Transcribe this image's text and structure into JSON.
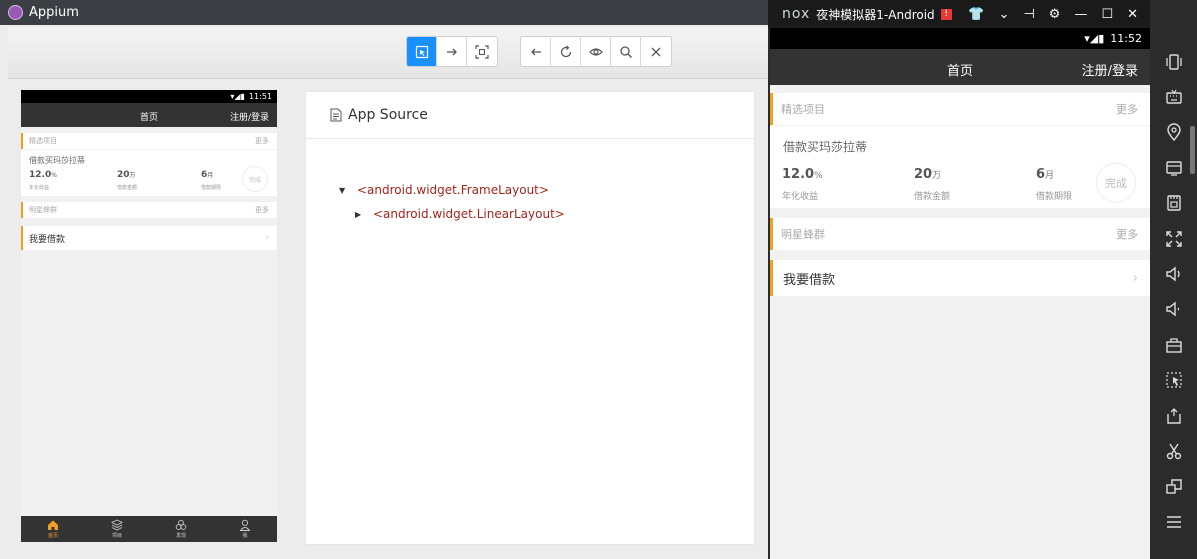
{
  "appium": {
    "title": "Appium",
    "toolbar": {
      "mode_buttons": [
        {
          "icon": "select-element-icon",
          "active": true
        },
        {
          "icon": "swipe-arrow-icon",
          "active": false
        },
        {
          "icon": "tap-coordinates-icon",
          "active": false
        }
      ],
      "nav_buttons": [
        {
          "icon": "back-arrow-icon"
        },
        {
          "icon": "refresh-icon"
        },
        {
          "icon": "eye-icon"
        },
        {
          "icon": "search-icon"
        },
        {
          "icon": "close-icon"
        }
      ]
    },
    "source": {
      "title": "App Source",
      "nodes": [
        {
          "caret": "▼",
          "label": "<android.widget.FrameLayout>"
        },
        {
          "caret": "▶",
          "label": "<android.widget.LinearLayout>"
        }
      ]
    }
  },
  "mini_phone": {
    "status_time": "11:51",
    "bottom_nav": [
      "首页",
      "项目",
      "发现",
      "我"
    ]
  },
  "nox": {
    "brand": "nox",
    "title": "夜神模拟器1-Android",
    "warning": "!",
    "status_time": "11:52"
  },
  "app": {
    "header_title": "首页",
    "header_right": "注册/登录",
    "featured": {
      "label": "精选项目",
      "more": "更多"
    },
    "project": {
      "name": "借款买玛莎拉蒂",
      "stats": [
        {
          "value": "12.0",
          "unit": "%",
          "label": "年化收益"
        },
        {
          "value": "20",
          "unit": "万",
          "label": "借款金额"
        },
        {
          "value": "6",
          "unit": "月",
          "label": "借款期限"
        }
      ],
      "status": "完成"
    },
    "star": {
      "label": "明星蜂群",
      "more": "更多"
    },
    "loan": {
      "label": "我要借款",
      "chevron": "›"
    }
  },
  "colors": {
    "accent": "#f0a020",
    "appium_active": "#1890ff",
    "header": "#333333",
    "xml_tag": "#a1261c"
  }
}
